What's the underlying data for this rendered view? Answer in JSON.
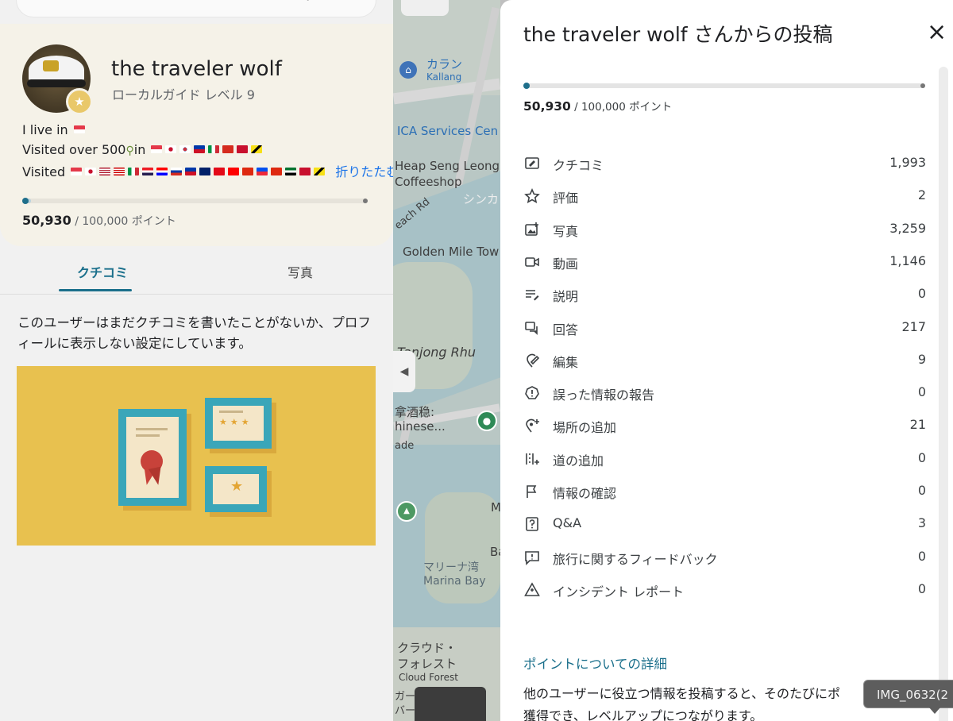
{
  "profile": {
    "name": "the traveler wolf",
    "level": "ローカルガイド レベル 9",
    "bio_live_prefix": "I live in",
    "bio_visited_over": "Visited over 500",
    "bio_in": "in",
    "bio_visited": "Visited",
    "collapse_label": "折りたたむ",
    "points_current": "50,930",
    "points_total": " / 100,000 ポイント",
    "progress_fraction": 0.5093
  },
  "tabs": [
    {
      "label": "クチコミ",
      "selected": true
    },
    {
      "label": "写真",
      "selected": false
    }
  ],
  "no_reviews_text": "このユーザーはまだクチコミを書いたことがないか、プロフィールに表示しない設定にしています。",
  "map": {
    "labels": {
      "kallang_jp": "カラン",
      "kallang": "Kallang",
      "ica": "ICA Services Cen",
      "heap_seng": "Heap Seng Leong",
      "coffeeshop": "Coffeeshop",
      "shinka": "シンカ",
      "each_rd": "each Rd",
      "golden_mile": "Golden Mile Tow",
      "tanjong_rhu": "Tanjong Rhu",
      "chinese_jp": "拿酒稳:",
      "chinese": "hinese...",
      "ade": "ade",
      "m": "M",
      "ba": "Ba",
      "marina_jp": "マリーナ湾",
      "marina": "Marina Bay",
      "cloud_jp1": "クラウド・",
      "cloud_jp2": "フォレスト",
      "cloud": "Cloud Forest",
      "garden_jp": "ガー",
      "garden_jp2": "バー"
    }
  },
  "dialog": {
    "title": "the traveler wolf さんからの投稿",
    "close_icon": "×",
    "points_current": "50,930",
    "points_total": " / 100,000 ポイント",
    "progress_fraction": 0.5093,
    "stats": [
      {
        "icon": "review-icon",
        "label": "クチコミ",
        "value": "1,993"
      },
      {
        "icon": "star-icon",
        "label": "評価",
        "value": "2"
      },
      {
        "icon": "photo-icon",
        "label": "写真",
        "value": "3,259"
      },
      {
        "icon": "video-icon",
        "label": "動画",
        "value": "1,146"
      },
      {
        "icon": "description-icon",
        "label": "説明",
        "value": "0"
      },
      {
        "icon": "answer-icon",
        "label": "回答",
        "value": "217"
      },
      {
        "icon": "edit-icon",
        "label": "編集",
        "value": "9"
      },
      {
        "icon": "report-icon",
        "label": "誤った情報の報告",
        "value": "0"
      },
      {
        "icon": "add-place-icon",
        "label": "場所の追加",
        "value": "21"
      },
      {
        "icon": "add-road-icon",
        "label": "道の追加",
        "value": "0"
      },
      {
        "icon": "flag-icon",
        "label": "情報の確認",
        "value": "0"
      },
      {
        "icon": "qa-icon",
        "label": "Q&A",
        "value": "3"
      },
      {
        "icon": "feedback-icon",
        "label": "旅行に関するフィードバック",
        "value": "0"
      },
      {
        "icon": "incident-icon",
        "label": "インシデント レポート",
        "value": "0"
      }
    ],
    "points_link": "ポイントについての詳細",
    "points_desc_line1": "他のユーザーに役立つ情報を投稿すると、そのたびにポ",
    "points_desc_line2": "獲得でき、レベルアップにつながります。"
  },
  "tooltip": "IMG_0632(2"
}
